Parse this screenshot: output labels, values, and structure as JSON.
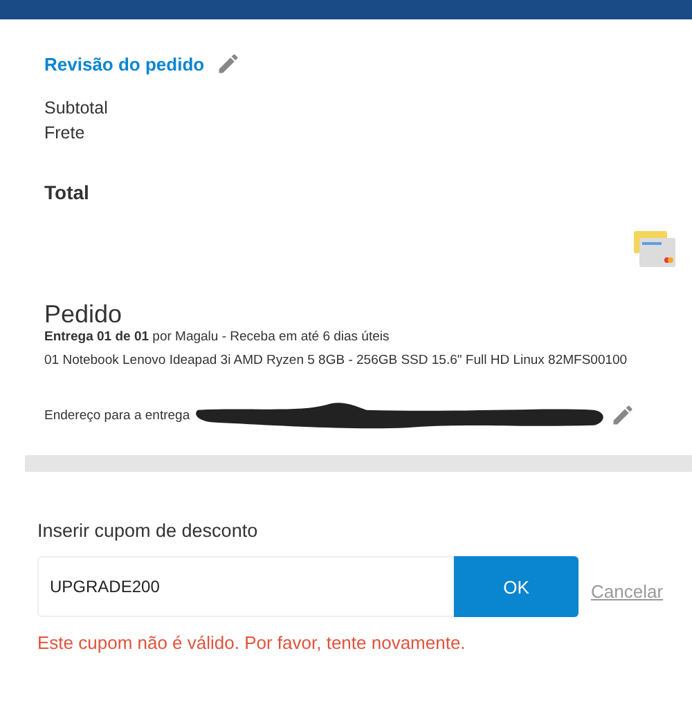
{
  "review": {
    "title": "Revisão do pedido",
    "lines": [
      "Subtotal",
      "Frete"
    ],
    "total": "Total"
  },
  "order": {
    "title": "Pedido",
    "delivery": "**Entrega 01 de 01** por Magalu - Receba em até 6 dias úteis",
    "product": "01 Notebook Lenovo Ideapad 3i AMD Ryzen 5 8GB - 256GB SSD 15.6\" Full HD Linux 82MFS00100",
    "address_label": "Endereço para a entrega"
  },
  "coupon": {
    "label": "Inserir cupom de desconto",
    "value": "UPGRADE200",
    "submit": "OK",
    "cancel": "Cancelar",
    "error": "Este cupom não é válido. Por favor, tente novamente."
  }
}
